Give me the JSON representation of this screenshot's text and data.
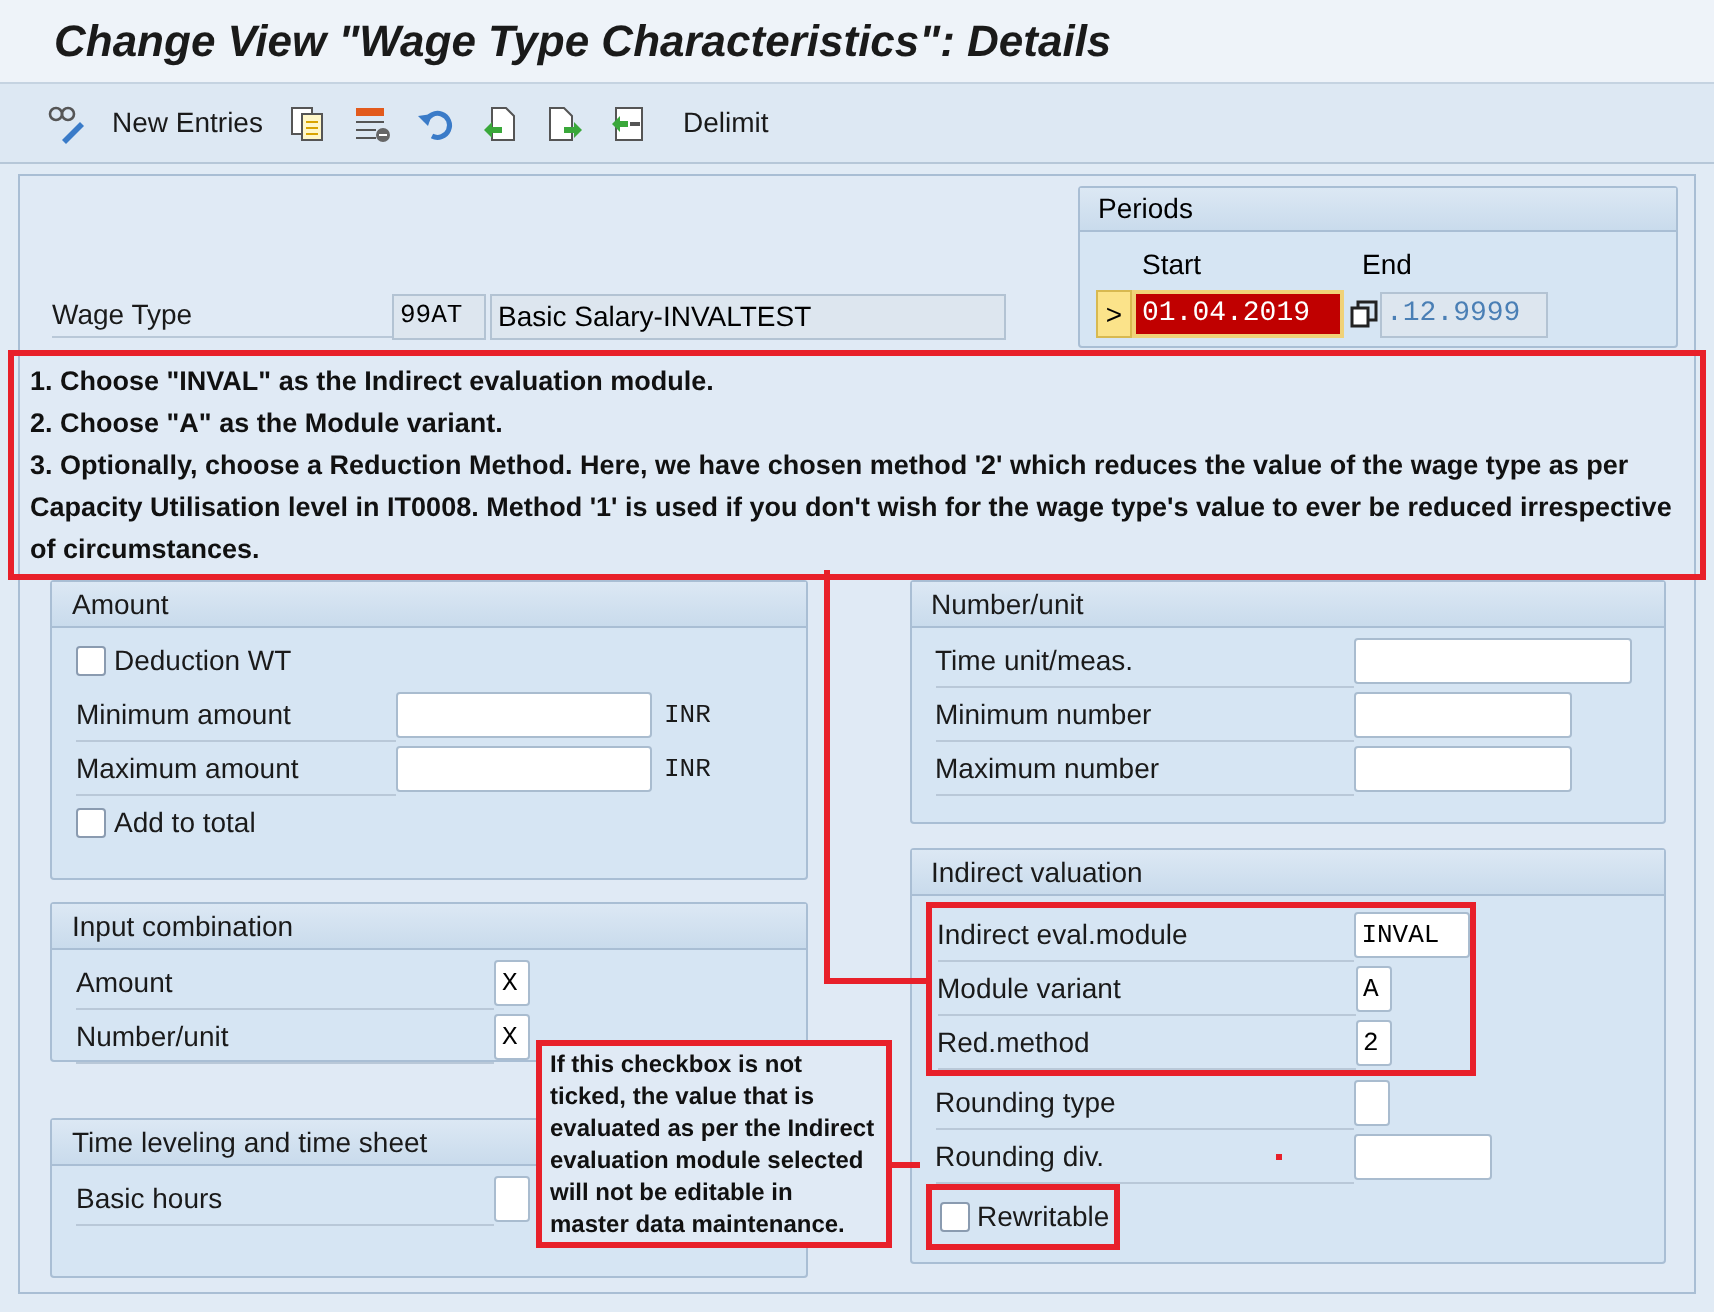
{
  "title": "Change View \"Wage Type Characteristics\": Details",
  "toolbar": {
    "new_entries": "New Entries",
    "delimit": "Delimit"
  },
  "wage_type": {
    "label": "Wage Type",
    "code": "99AT",
    "text": "Basic Salary-INVALTEST"
  },
  "periods": {
    "title": "Periods",
    "start_label": "Start",
    "end_label": "End",
    "marker": ">",
    "start": "01.04.2019",
    "start_error": true,
    "end": ".12.9999"
  },
  "annotation_1": [
    "1.  Choose \"INVAL\" as the Indirect evaluation module.",
    "2.  Choose \"A\" as the Module variant.",
    "3.  Optionally, choose a Reduction Method.  Here, we have chosen method '2' which reduces the value of the wage type as per Capacity Utilisation level in IT0008.  Method '1' is used if you don't wish for the wage type's value to ever be reduced irrespective of circumstances."
  ],
  "left_groups": [
    {
      "title": "Amount",
      "rows": [
        {
          "kind": "checkbox",
          "label": "Deduction WT",
          "checked": false,
          "annotated": false
        },
        {
          "kind": "field",
          "label": "Minimum amount",
          "unit": "INR",
          "annotated": false
        },
        {
          "kind": "field",
          "label": "Maximum amount",
          "unit": "INR",
          "annotated": false
        },
        {
          "kind": "checkbox",
          "label": "Add to total",
          "checked": false,
          "annotated": false
        }
      ]
    },
    {
      "title": "Input combination",
      "rows": [
        {
          "kind": "field",
          "label": "Amount",
          "value": "X",
          "annotated": false
        },
        {
          "kind": "field",
          "label": "Number/unit",
          "value": "X",
          "annotated": false
        }
      ]
    },
    {
      "title": "Time leveling and time sheet",
      "rows": [
        {
          "kind": "field",
          "label": "Basic hours",
          "annotated": false
        }
      ]
    }
  ],
  "right_groups": [
    {
      "title": "Number/unit",
      "rows": [
        {
          "kind": "field",
          "label": "Time unit/meas.",
          "annotated": false
        },
        {
          "kind": "field",
          "label": "Minimum number",
          "annotated": false
        },
        {
          "kind": "field",
          "label": "Maximum number",
          "annotated": false
        }
      ]
    },
    {
      "title": "Indirect valuation",
      "rows": [
        {
          "kind": "field",
          "label": "Indirect eval.module",
          "value": "INVAL",
          "annotated": true
        },
        {
          "kind": "field",
          "label": "Module variant",
          "value": "A",
          "annotated": true
        },
        {
          "kind": "field",
          "label": "Red.method",
          "value": "2",
          "annotated": true
        },
        {
          "kind": "field",
          "label": "Rounding type",
          "annotated": false
        },
        {
          "kind": "field",
          "label": "Rounding div.",
          "annotated": false
        },
        {
          "kind": "checkbox",
          "label": "Rewritable",
          "checked": false,
          "annotated": true
        }
      ]
    }
  ],
  "annotation_2": "If this checkbox is not ticked, the value that is evaluated as per the Indirect evaluation module selected will not be editable in master data maintenance."
}
